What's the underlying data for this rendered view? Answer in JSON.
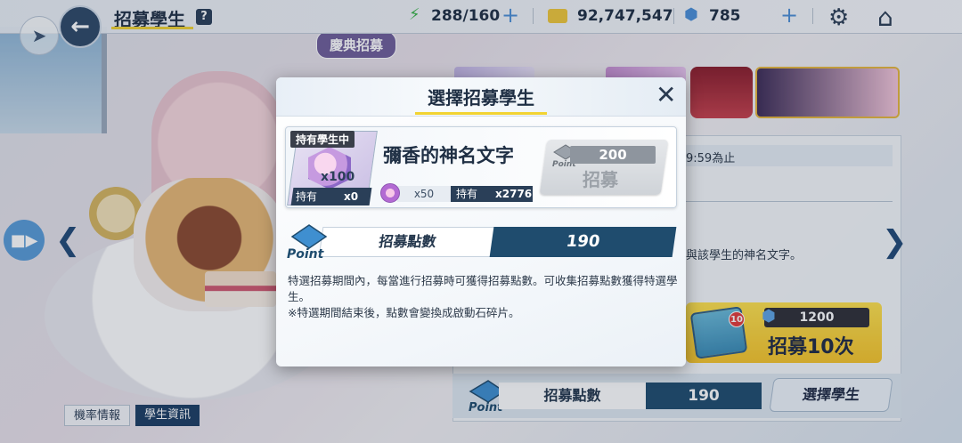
{
  "header": {
    "title": "招募學生",
    "help_label": "?",
    "ap": "288/160",
    "credits": "92,747,547",
    "gems": "785"
  },
  "background": {
    "banner_label": "慶典招募",
    "date_text": "9:59為止",
    "desc_text": "與該學生的神名文字。",
    "recruit10": {
      "mail_badge": "10",
      "cost": "1200",
      "label": "招募10次"
    },
    "points": {
      "label": "招募點數",
      "value": "190"
    },
    "select_student_label": "選擇學生",
    "tabs": {
      "rate": "機率情報",
      "info": "學生資訊"
    }
  },
  "modal": {
    "title": "選擇招募學生",
    "item": {
      "owned_tag": "持有學生中",
      "qty": "x100",
      "owned_label": "持有",
      "owned_count": "x0",
      "name": "彌香的神名文字",
      "cost_qty": "x50",
      "have_label": "持有",
      "have_count": "x2776"
    },
    "recruit_button": {
      "cost": "200",
      "label": "招募"
    },
    "points": {
      "label": "招募點數",
      "value": "190"
    },
    "description": [
      "特選招募期間內，每當進行招募時可獲得招募點數。可收集招募點數獲得特選學生。",
      "※特選期間結束後，點數會變換成啟動石碎片。"
    ]
  }
}
